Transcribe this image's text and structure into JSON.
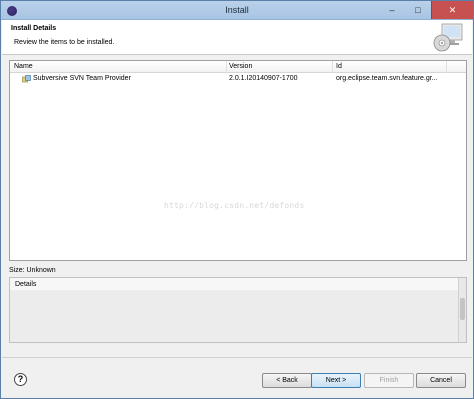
{
  "window": {
    "title": "Install",
    "controls": {
      "minimize": "–",
      "maximize": "□",
      "close": "✕"
    }
  },
  "header": {
    "title": "Install Details",
    "subtitle": "Review the items to be installed."
  },
  "table": {
    "columns": [
      "Name",
      "Version",
      "Id"
    ],
    "rows": [
      {
        "name": "Subversive SVN Team Provider",
        "version": "2.0.1.I20140907-1700",
        "id": "org.eclipse.team.svn.feature.gr...",
        "icon": "feature-plugin-icon"
      }
    ]
  },
  "watermark": "http://blog.csdn.net/defonds",
  "size": "Size: Unknown",
  "details": {
    "label": "Details"
  },
  "buttons": {
    "help": "?",
    "back": "< Back",
    "next": "Next >",
    "finish": "Finish",
    "cancel": "Cancel"
  },
  "colors": {
    "accent": "#3c7fb1",
    "close": "#c75050",
    "titlebar": "#b9d1ea"
  }
}
